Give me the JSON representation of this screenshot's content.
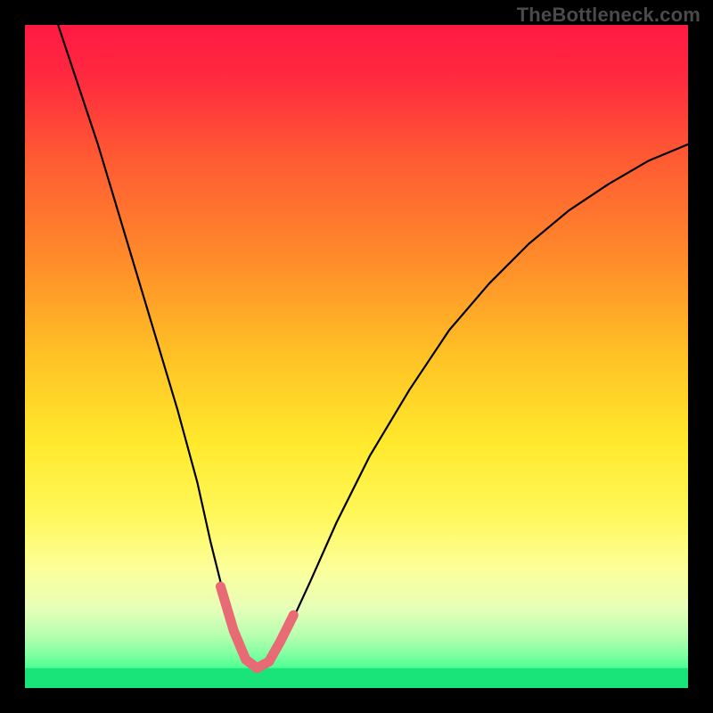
{
  "watermark": "TheBottleneck.com",
  "chart_data": {
    "type": "line",
    "title": "",
    "xlabel": "",
    "ylabel": "",
    "xlim": [
      0,
      100
    ],
    "ylim": [
      0,
      100
    ],
    "gradient_stops": [
      {
        "offset": 0.0,
        "color": "#ff1a43"
      },
      {
        "offset": 0.08,
        "color": "#ff2a3f"
      },
      {
        "offset": 0.2,
        "color": "#ff5a33"
      },
      {
        "offset": 0.35,
        "color": "#ff8a2a"
      },
      {
        "offset": 0.5,
        "color": "#ffc225"
      },
      {
        "offset": 0.63,
        "color": "#ffe92c"
      },
      {
        "offset": 0.74,
        "color": "#fff85a"
      },
      {
        "offset": 0.82,
        "color": "#fcff9a"
      },
      {
        "offset": 0.88,
        "color": "#e6ffb8"
      },
      {
        "offset": 0.92,
        "color": "#b8ffb0"
      },
      {
        "offset": 0.95,
        "color": "#7fffa0"
      },
      {
        "offset": 0.975,
        "color": "#3fff90"
      },
      {
        "offset": 1.0,
        "color": "#16f57e"
      }
    ],
    "background_bottom_band": {
      "x0": 0,
      "x1": 100,
      "y0": 0,
      "y1": 3,
      "color": "#18e47a"
    },
    "series": [
      {
        "name": "bottleneck-curve",
        "color": "#000000",
        "stroke_width": 2.2,
        "x": [
          5,
          8,
          11,
          14,
          17,
          20,
          23,
          26,
          28,
          30,
          31.5,
          33,
          34,
          35,
          36.5,
          38,
          40,
          43,
          47,
          52,
          58,
          64,
          70,
          76,
          82,
          88,
          94,
          100
        ],
        "y": [
          100,
          91,
          82,
          72,
          62,
          52,
          42,
          31,
          22,
          14,
          9,
          5.5,
          3.5,
          2.5,
          3.3,
          5.3,
          9.5,
          16,
          25,
          35,
          45,
          54,
          61,
          67,
          72,
          76,
          79.5,
          82
        ]
      },
      {
        "name": "marker-band-left",
        "color": "#e86a75",
        "stroke_width": 11,
        "linecap": "round",
        "x": [
          29.5,
          31.5,
          33.3
        ],
        "y": [
          15.3,
          8.6,
          4.3
        ]
      },
      {
        "name": "marker-band-bottom",
        "color": "#e86a75",
        "stroke_width": 11,
        "linecap": "round",
        "x": [
          33.3,
          35.0,
          36.8
        ],
        "y": [
          4.3,
          3.0,
          4.0
        ]
      },
      {
        "name": "marker-band-right",
        "color": "#e86a75",
        "stroke_width": 11,
        "linecap": "round",
        "x": [
          36.8,
          38.5,
          40.5
        ],
        "y": [
          4.0,
          7.0,
          11.0
        ]
      }
    ]
  }
}
